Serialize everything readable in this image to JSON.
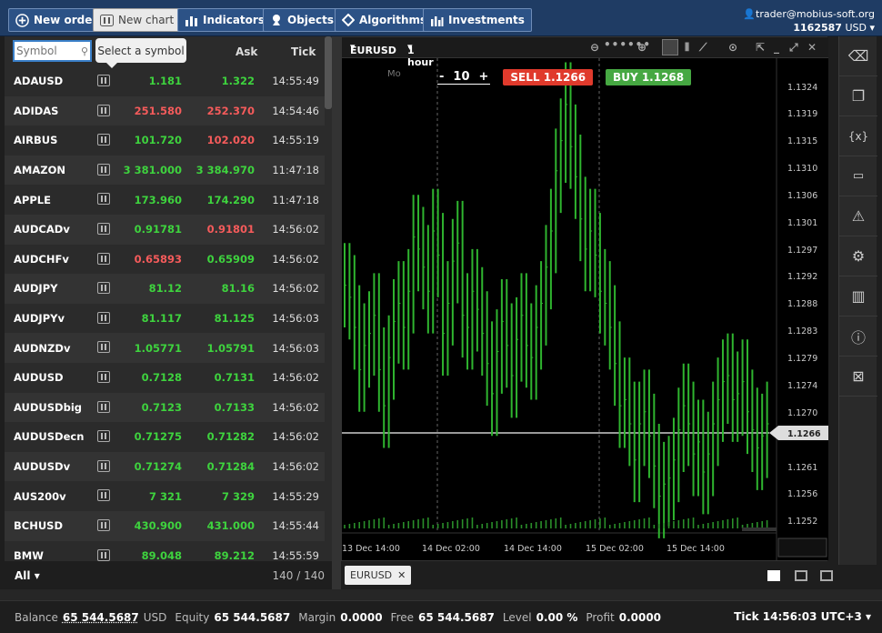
{
  "toolbar": {
    "new_order": "New order",
    "new_chart": "New chart",
    "indicators": "Indicators",
    "objects": "Objects",
    "algorithms": "Algorithms",
    "investments": "Investments"
  },
  "account": {
    "email": "trader@mobius-soft.org",
    "number": "1162587",
    "currency": "USD"
  },
  "watchlist": {
    "search_placeholder": "Symbol",
    "tooltip": "Select a symbol",
    "columns": {
      "ask": "Ask",
      "tick": "Tick"
    },
    "rows": [
      {
        "symbol": "ADAUSD",
        "bid": "1.181",
        "ask": "1.322",
        "tick": "14:55:49",
        "bid_color": "g",
        "ask_color": "g"
      },
      {
        "symbol": "ADIDAS",
        "bid": "251.580",
        "ask": "252.370",
        "tick": "14:54:46",
        "bid_color": "r",
        "ask_color": "r"
      },
      {
        "symbol": "AIRBUS",
        "bid": "101.720",
        "ask": "102.020",
        "tick": "14:55:19",
        "bid_color": "g",
        "ask_color": "r"
      },
      {
        "symbol": "AMAZON",
        "bid": "3 381.000",
        "ask": "3 384.970",
        "tick": "11:47:18",
        "bid_color": "g",
        "ask_color": "g"
      },
      {
        "symbol": "APPLE",
        "bid": "173.960",
        "ask": "174.290",
        "tick": "11:47:18",
        "bid_color": "g",
        "ask_color": "g"
      },
      {
        "symbol": "AUDCADv",
        "bid": "0.91781",
        "ask": "0.91801",
        "tick": "14:56:02",
        "bid_color": "g",
        "ask_color": "r"
      },
      {
        "symbol": "AUDCHFv",
        "bid": "0.65893",
        "ask": "0.65909",
        "tick": "14:56:02",
        "bid_color": "r",
        "ask_color": "g"
      },
      {
        "symbol": "AUDJPY",
        "bid": "81.12",
        "ask": "81.16",
        "tick": "14:56:02",
        "bid_color": "g",
        "ask_color": "g"
      },
      {
        "symbol": "AUDJPYv",
        "bid": "81.117",
        "ask": "81.125",
        "tick": "14:56:03",
        "bid_color": "g",
        "ask_color": "g"
      },
      {
        "symbol": "AUDNZDv",
        "bid": "1.05771",
        "ask": "1.05791",
        "tick": "14:56:03",
        "bid_color": "g",
        "ask_color": "g"
      },
      {
        "symbol": "AUDUSD",
        "bid": "0.7128",
        "ask": "0.7131",
        "tick": "14:56:02",
        "bid_color": "g",
        "ask_color": "g"
      },
      {
        "symbol": "AUDUSDbig",
        "bid": "0.7123",
        "ask": "0.7133",
        "tick": "14:56:02",
        "bid_color": "g",
        "ask_color": "g"
      },
      {
        "symbol": "AUDUSDecn",
        "bid": "0.71275",
        "ask": "0.71282",
        "tick": "14:56:02",
        "bid_color": "g",
        "ask_color": "g"
      },
      {
        "symbol": "AUDUSDv",
        "bid": "0.71274",
        "ask": "0.71284",
        "tick": "14:56:02",
        "bid_color": "g",
        "ask_color": "g"
      },
      {
        "symbol": "AUS200v",
        "bid": "7 321",
        "ask": "7 329",
        "tick": "14:55:29",
        "bid_color": "g",
        "ask_color": "g"
      },
      {
        "symbol": "BCHUSD",
        "bid": "430.900",
        "ask": "431.000",
        "tick": "14:55:44",
        "bid_color": "g",
        "ask_color": "g"
      },
      {
        "symbol": "BMW",
        "bid": "89.048",
        "ask": "89.212",
        "tick": "14:55:59",
        "bid_color": "g",
        "ask_color": "g"
      }
    ],
    "footer": {
      "filter": "All",
      "count": "140 / 140"
    }
  },
  "chart": {
    "symbol": "EURUSD",
    "timeframe": "1 hour",
    "lot": "10",
    "sell_label": "SELL",
    "sell_price": "1.1266",
    "buy_label": "BUY",
    "buy_price": "1.1268",
    "week_marker": "Mo",
    "tab": "EURUSD",
    "current_price": "1.1266",
    "price_ticks": [
      "1.1324",
      "1.1319",
      "1.1315",
      "1.1310",
      "1.1306",
      "1.1301",
      "1.1297",
      "1.1292",
      "1.1288",
      "1.1283",
      "1.1279",
      "1.1274",
      "1.1270",
      "1.1261",
      "1.1256",
      "1.1252"
    ],
    "time_ticks": [
      "13 Dec 14:00",
      "14 Dec 02:00",
      "14 Dec 14:00",
      "15 Dec 02:00",
      "15 Dec 14:00"
    ],
    "colors": {
      "up": "#2fb52f",
      "current": "#cccccc"
    }
  },
  "status": {
    "balance_label": "Balance",
    "balance": "65 544.5687",
    "balance_ccy": "USD",
    "equity_label": "Equity",
    "equity": "65 544.5687",
    "margin_label": "Margin",
    "margin": "0.0000",
    "free_label": "Free",
    "free": "65 544.5687",
    "level_label": "Level",
    "level": "0.00 %",
    "profit_label": "Profit",
    "profit": "0.0000",
    "tick_label": "Tick",
    "tick_time": "14:56:03",
    "tz": "UTC+3"
  }
}
